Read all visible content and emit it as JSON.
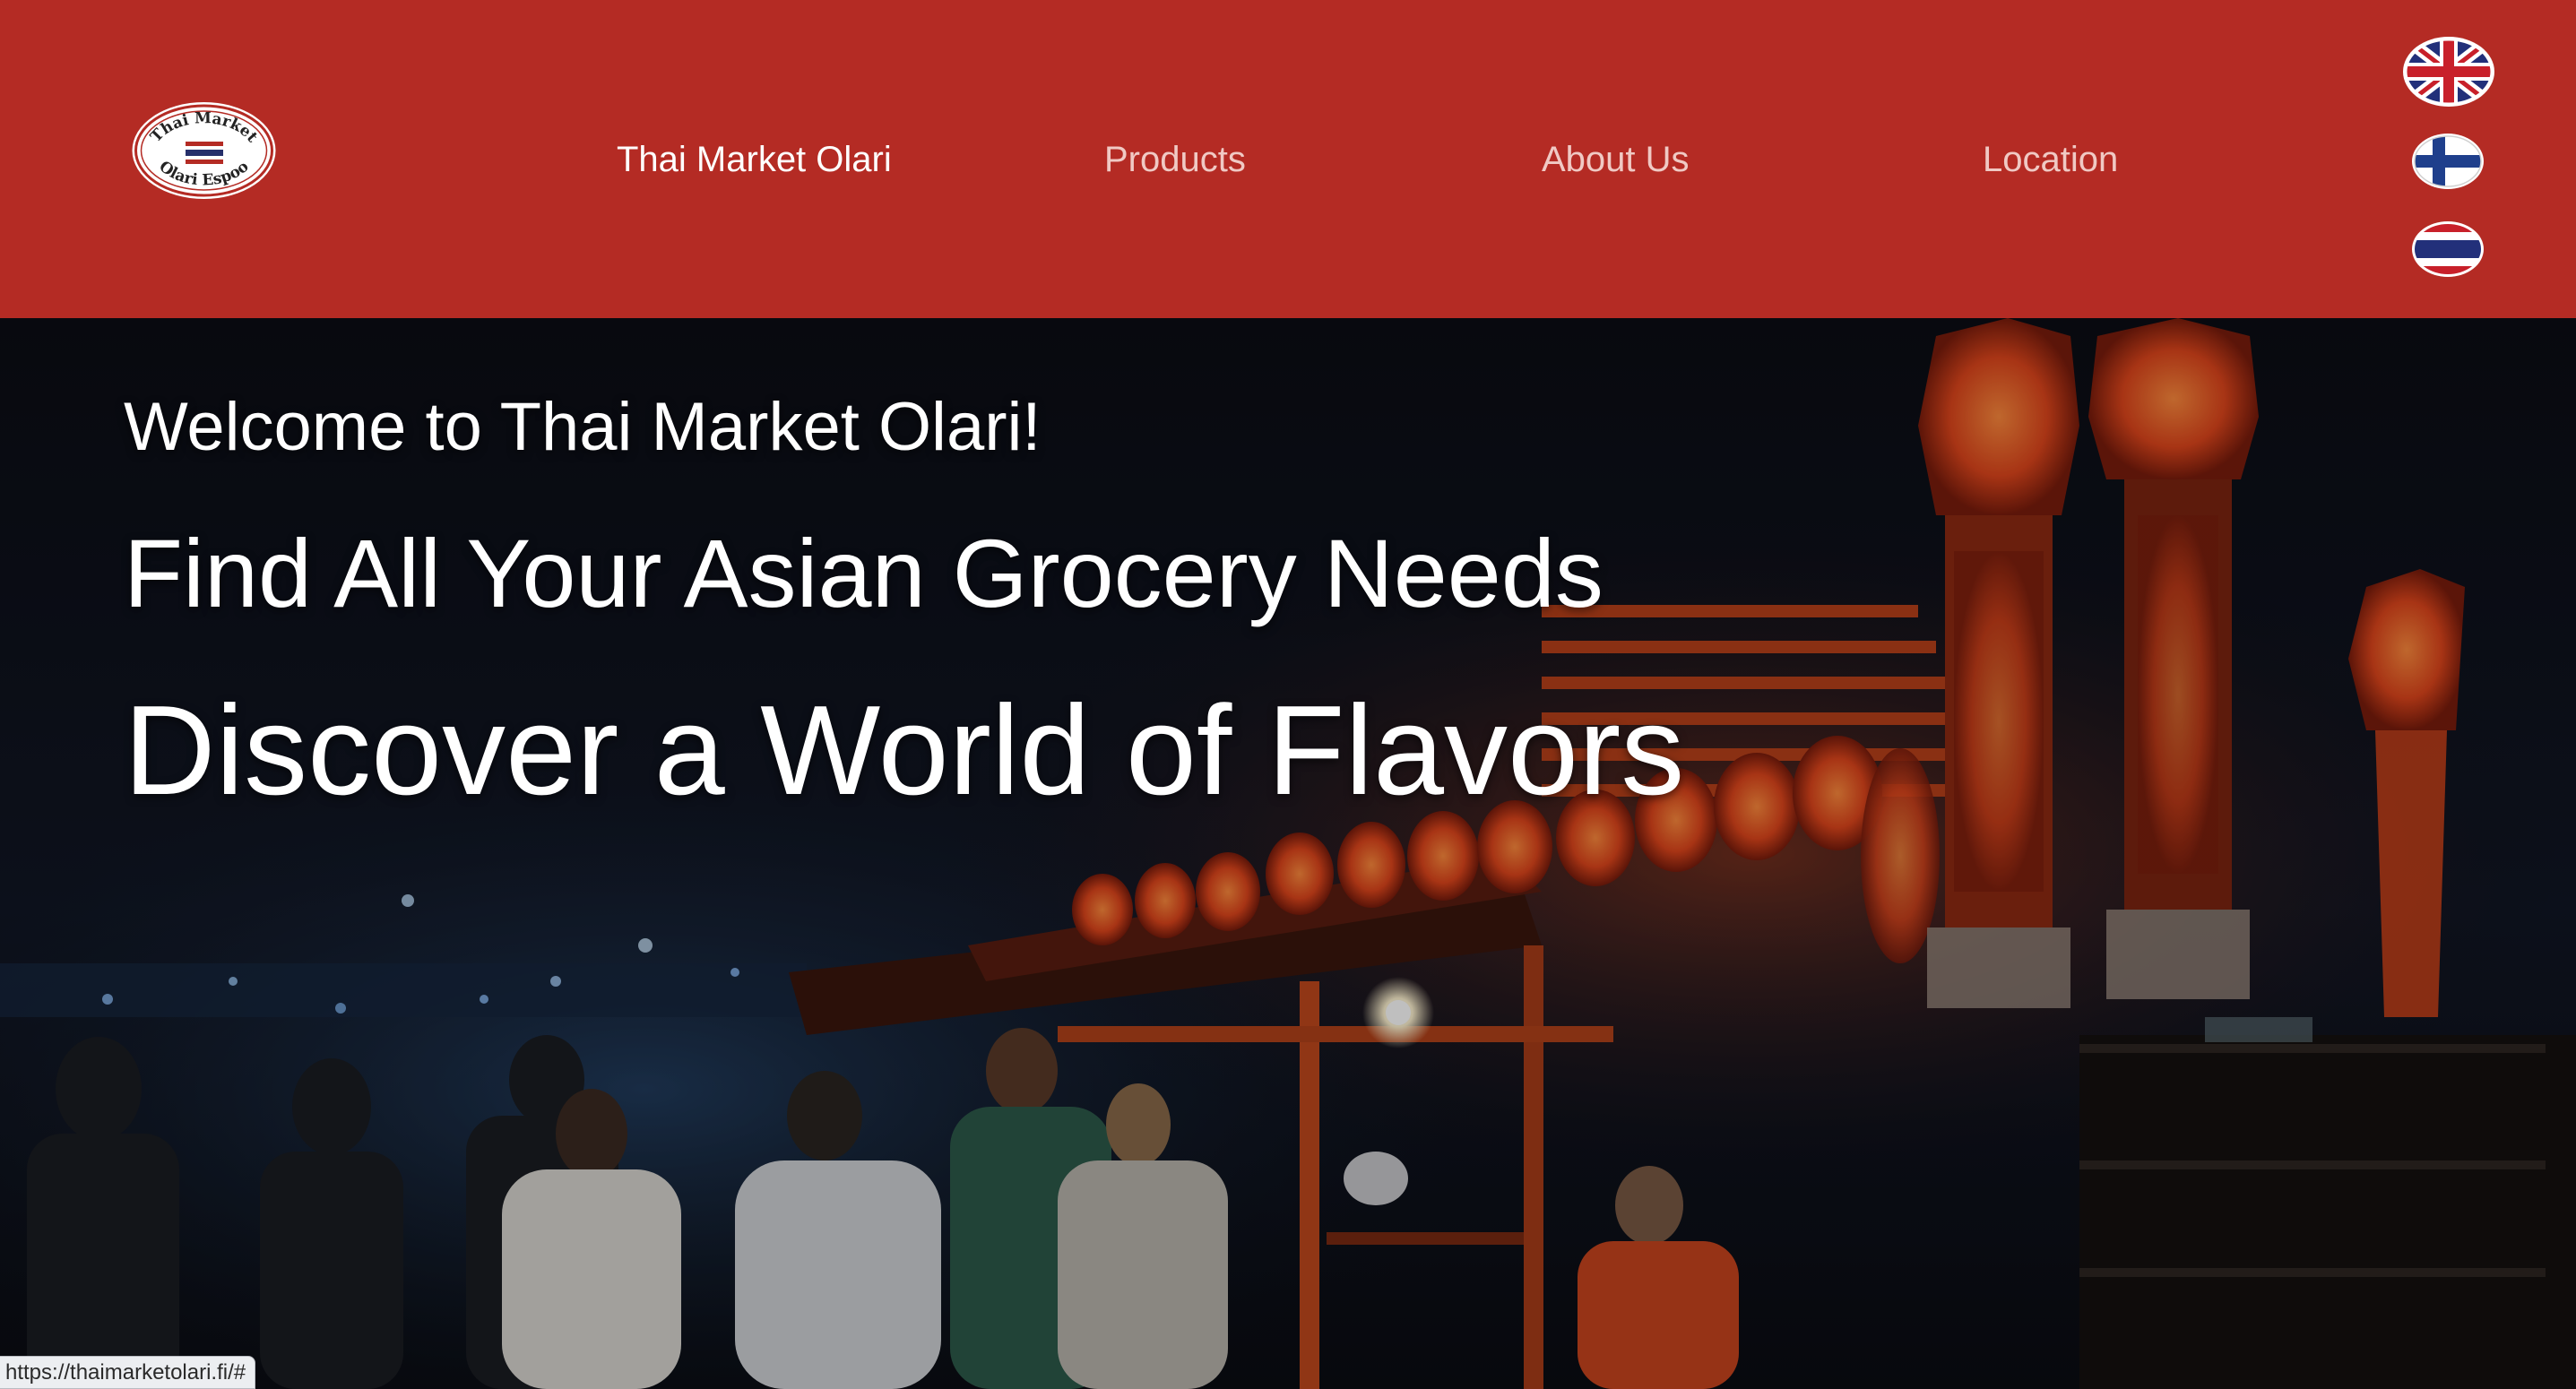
{
  "logo": {
    "top_text": "Thai Market",
    "bottom_text": "Olari Espoo"
  },
  "nav": {
    "items": [
      {
        "label": "Thai Market Olari",
        "active": true
      },
      {
        "label": "Products",
        "active": false
      },
      {
        "label": "About Us",
        "active": false
      },
      {
        "label": "Location",
        "active": false
      }
    ]
  },
  "languages": [
    {
      "name": "English",
      "icon": "uk-flag-icon"
    },
    {
      "name": "Finnish",
      "icon": "finland-flag-icon"
    },
    {
      "name": "Thai",
      "icon": "thailand-flag-icon"
    }
  ],
  "hero": {
    "welcome": "Welcome to Thai Market Olari!",
    "headline": "Find All Your Asian Grocery Needs",
    "tagline": "Discover a World of Flavors"
  },
  "status_bar": {
    "url": "https://thaimarketolari.fi/#"
  },
  "colors": {
    "header_bg": "#b42b24",
    "nav_text": "#f0c9c4",
    "nav_active": "#ffffff"
  }
}
